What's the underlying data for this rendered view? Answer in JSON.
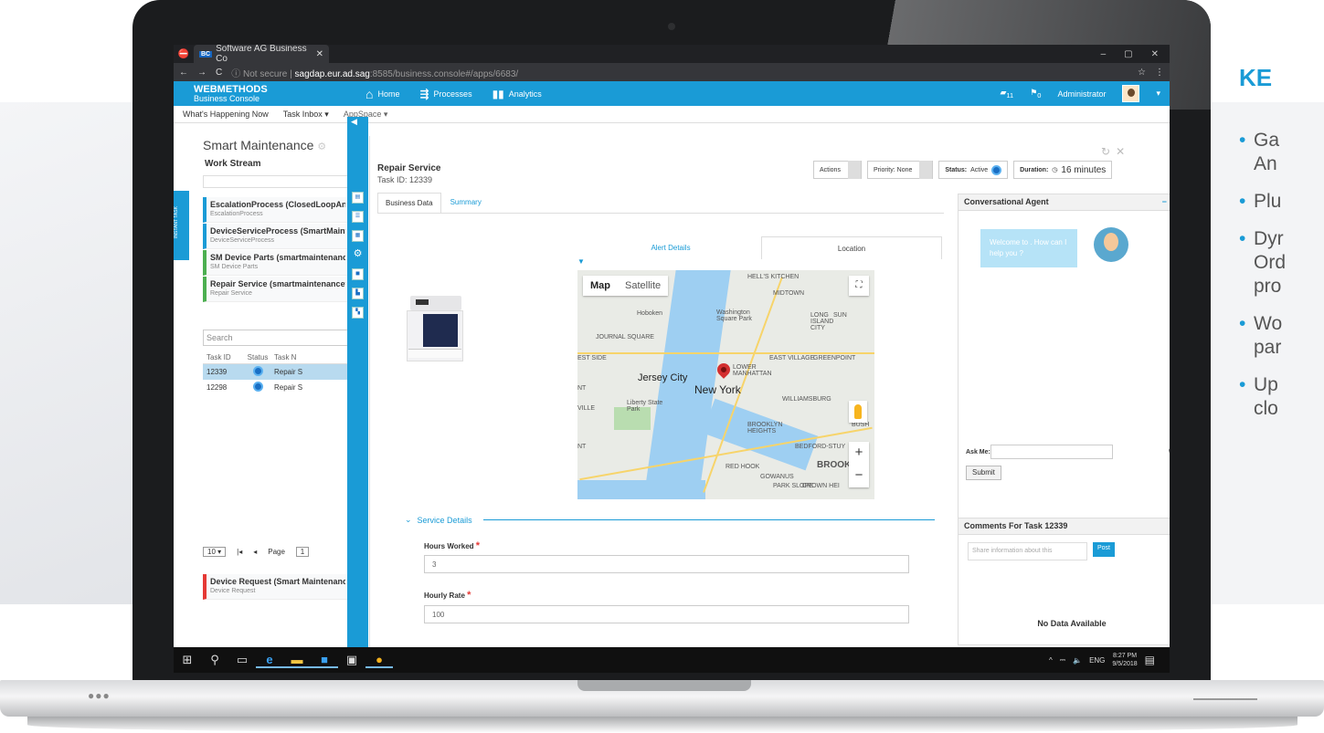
{
  "slide": {
    "heading": "KE",
    "bullets": [
      "Ga",
      "An",
      "Plu",
      "Dyr",
      "Ord",
      "pro",
      "Wo",
      "par",
      "Up",
      "clo"
    ]
  },
  "browser": {
    "tab_label": "Software AG Business Co",
    "tab_icon": "BC",
    "url_notsecure": "Not secure",
    "url_host": "sagdap.eur.ad.sag",
    "url_path": ":8585/business.console#/apps/6683/"
  },
  "app": {
    "logo_line1": "WEBMETHODS",
    "logo_line2": "Business Console",
    "nav": [
      "Home",
      "Processes",
      "Analytics"
    ],
    "badge1": "11",
    "badge2": "0",
    "user": "Administrator"
  },
  "subnav": [
    "What's Happening Now",
    "Task Inbox ▾",
    "AppSpace ▾"
  ],
  "left": {
    "title": "Smart Maintenance",
    "work_stream": "Work Stream",
    "instant_task": "INSTANT TASK",
    "processes": [
      {
        "title": "EscalationProcess (ClosedLoopAna",
        "sub": "EscalationProcess"
      },
      {
        "title": "DeviceServiceProcess (SmartMaint",
        "sub": "DeviceServiceProcess"
      },
      {
        "title": "SM Device Parts (smartmaintenanc",
        "sub": "SM Device Parts"
      },
      {
        "title": "Repair Service (smartmaintenancet",
        "sub": "Repair Service"
      }
    ],
    "search_placeholder": "Search",
    "table": {
      "headers": [
        "Task ID",
        "Status",
        "Task N"
      ],
      "rows": [
        {
          "id": "12339",
          "name": "Repair S"
        },
        {
          "id": "12298",
          "name": "Repair S"
        }
      ]
    },
    "pager": {
      "size": "10 ▾",
      "first": "|◂",
      "prev": "◂",
      "page_label": "Page",
      "page": "1"
    },
    "device_request": {
      "title": "Device Request (Smart Maintenanc",
      "sub": "Device Request"
    }
  },
  "modal": {
    "title": "Repair Service",
    "task_id": "Task ID: 12339",
    "actions": "Actions",
    "priority": "Priority: None",
    "status_label": "Status:",
    "status_value": "Active",
    "duration_label": "Duration:",
    "duration_value": "16 minutes",
    "tabs": [
      "Business Data",
      "Summary"
    ],
    "inner_tabs": [
      "Alert Details",
      "Location"
    ],
    "map": {
      "btn_map": "Map",
      "btn_satellite": "Satellite",
      "labels": [
        "HELL'S KITCHEN",
        "MIDTOWN",
        "Hoboken",
        "Washington Square Park",
        "LONG ISLAND CITY",
        "SUN",
        "JOURNAL SQUARE",
        "EAST VILLAGE",
        "GREENPOINT",
        "EST SIDE",
        "Jersey City",
        "LOWER MANHATTAN",
        "NT",
        "New York",
        "WILLIAMSBURG",
        "Liberty State Park",
        "VILLE",
        "BROOKLYN HEIGHTS",
        "BUSH",
        "BEDFORD-STUY",
        "NT",
        "RED HOOK",
        "GOWANUS",
        "PARK SLOPE",
        "CROWN HEI",
        "BROOKL"
      ]
    },
    "service_details": "Service Details",
    "fields": [
      {
        "label": "Hours Worked",
        "value": "3"
      },
      {
        "label": "Hourly Rate",
        "value": "100"
      }
    ]
  },
  "agent": {
    "title": "Conversational Agent",
    "welcome": "Welcome to . How can I help you ?",
    "ask_me": "Ask Me:",
    "submit": "Submit"
  },
  "comments": {
    "title": "Comments For Task 12339",
    "placeholder": "Share information about this",
    "post": "Post",
    "no_data": "No Data Available"
  },
  "taskbar": {
    "lang": "ENG",
    "time": "8:27 PM",
    "date": "9/5/2018"
  }
}
